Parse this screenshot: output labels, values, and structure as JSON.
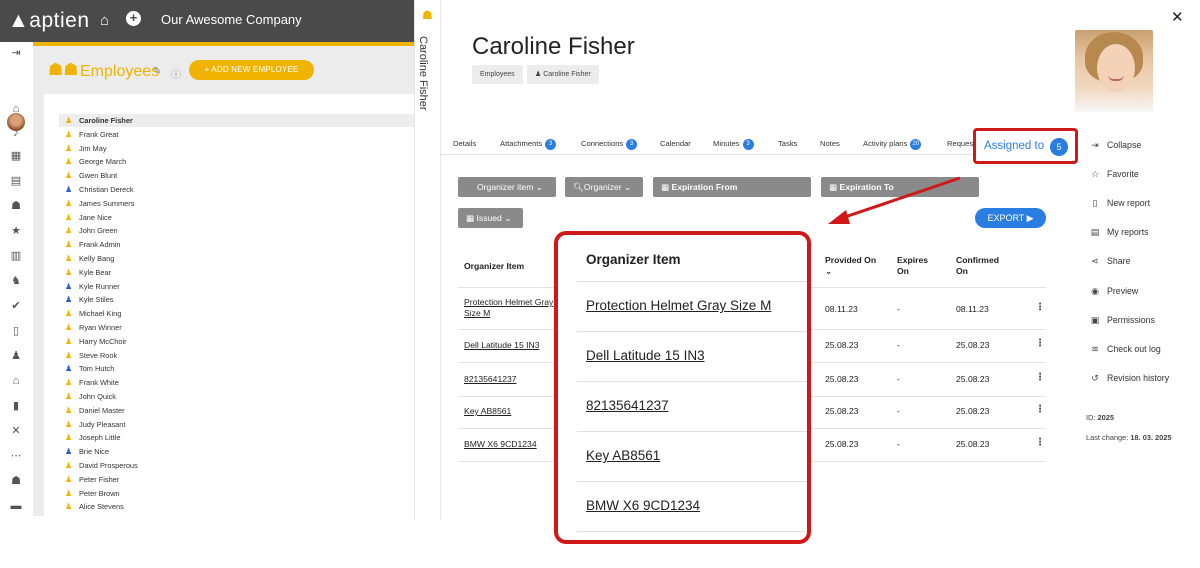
{
  "topbar": {
    "logo_text": "aptien",
    "company": "Our Awesome Company"
  },
  "icons": {
    "home": "home-icon",
    "add": "plus-circle-icon",
    "people": "people-icon",
    "close": "close-icon"
  },
  "employees": {
    "title": "Employees",
    "add_button": "+ ADD NEW EMPLOYEE",
    "list": [
      {
        "name": "Caroline Fisher",
        "selected": true,
        "color": "#f0b400"
      },
      {
        "name": "Frank Great",
        "color": "#f0b400"
      },
      {
        "name": "Jim May",
        "color": "#f0b400"
      },
      {
        "name": "George March",
        "color": "#f0b400"
      },
      {
        "name": "Gwen Blunt",
        "color": "#f0b400"
      },
      {
        "name": "Christian Dereck",
        "color": "#2a5bd7"
      },
      {
        "name": "James Summers",
        "color": "#f0b400"
      },
      {
        "name": "Jane Nice",
        "color": "#f0b400"
      },
      {
        "name": "John Green",
        "color": "#f0b400"
      },
      {
        "name": "Frank Admin",
        "color": "#f0b400"
      },
      {
        "name": "Kelly Bang",
        "color": "#f0b400"
      },
      {
        "name": "Kyle Bear",
        "color": "#f0b400"
      },
      {
        "name": "Kyle Runner",
        "color": "#2a5bd7"
      },
      {
        "name": "Kyle Stiles",
        "color": "#2a5bd7"
      },
      {
        "name": "Michael King",
        "color": "#f0b400"
      },
      {
        "name": "Ryan Winner",
        "color": "#f0b400"
      },
      {
        "name": "Harry McChoir",
        "color": "#f0b400"
      },
      {
        "name": "Steve Rook",
        "color": "#f0b400"
      },
      {
        "name": "Tom Hutch",
        "color": "#2a5bd7"
      },
      {
        "name": "Frank White",
        "color": "#f0b400"
      },
      {
        "name": "John Quick",
        "color": "#f0b400"
      },
      {
        "name": "Daniel Master",
        "color": "#f0b400"
      },
      {
        "name": "Judy Pleasant",
        "color": "#f0b400"
      },
      {
        "name": "Joseph Little",
        "color": "#f0b400"
      },
      {
        "name": "Brie Nice",
        "color": "#2a5bd7"
      },
      {
        "name": "David Prosperous",
        "color": "#f0b400"
      },
      {
        "name": "Peter Fisher",
        "color": "#f0b400"
      },
      {
        "name": "Peter Brown",
        "color": "#f0b400"
      },
      {
        "name": "Alice Stevens",
        "color": "#f0b400"
      }
    ]
  },
  "vertical_tab": "Caroline Fisher",
  "detail": {
    "name": "Caroline Fisher",
    "breadcrumbs": [
      "Employees",
      "Caroline Fisher"
    ],
    "tabs": [
      {
        "label": "Details"
      },
      {
        "label": "Attachments",
        "badge": "3"
      },
      {
        "label": "Connections",
        "badge": "3"
      },
      {
        "label": "Calendar"
      },
      {
        "label": "Minutes",
        "badge": "3"
      },
      {
        "label": "Tasks"
      },
      {
        "label": "Notes"
      },
      {
        "label": "Activity plans",
        "badge": "20"
      },
      {
        "label": "Reques"
      }
    ],
    "assigned_tab": {
      "label": "Assigned to",
      "badge": "5"
    },
    "filters": {
      "organizer_item": "Organizer item",
      "organizer": "Organizer",
      "expiration_from": "Expiration From",
      "expiration_to": "Expiration To",
      "issued": "Issued"
    },
    "export_label": "EXPORT",
    "table": {
      "headers": {
        "organizer_item": "Organizer Item",
        "provided_on": "Provided On",
        "expires_on": "Expires On",
        "confirmed_on": "Confirmed On"
      },
      "rows": [
        {
          "item": "Protection Helmet Gray Size M",
          "provided": "08.11.23",
          "expires": "-",
          "confirmed": "08.11.23"
        },
        {
          "item": "Dell Latitude 15 IN3",
          "provided": "25.08.23",
          "expires": "-",
          "confirmed": "25.08.23"
        },
        {
          "item": "82135641237",
          "provided": "25.08.23",
          "expires": "-",
          "confirmed": "25.08.23"
        },
        {
          "item": "Key AB8561",
          "provided": "25.08.23",
          "expires": "-",
          "confirmed": "25.08.23"
        },
        {
          "item": "BMW X6 9CD1234",
          "provided": "25.08.23",
          "expires": "-",
          "confirmed": "25.08.23"
        }
      ]
    }
  },
  "side_menu": [
    {
      "label": "Collapse",
      "icon": "collapse-icon"
    },
    {
      "label": "Favorite",
      "icon": "star-icon"
    },
    {
      "label": "New report",
      "icon": "report-icon"
    },
    {
      "label": "My reports",
      "icon": "reports-icon"
    },
    {
      "label": "Share",
      "icon": "share-icon"
    },
    {
      "label": "Preview",
      "icon": "eye-icon"
    },
    {
      "label": "Permissions",
      "icon": "permissions-icon"
    },
    {
      "label": "Check out log",
      "icon": "log-icon"
    },
    {
      "label": "Revision history",
      "icon": "history-icon"
    }
  ],
  "meta": {
    "id_label": "ID:",
    "id_value": "2025",
    "last_change_label": "Last change:",
    "last_change_value": "18. 03. 2025"
  },
  "zoom": {
    "header": "Organizer Item",
    "items": [
      "Protection Helmet Gray Size M",
      "Dell Latitude 15 IN3",
      "82135641237",
      "Key AB8561",
      "BMW X6 9CD1234"
    ]
  },
  "colors": {
    "accent": "#f0b400",
    "primary": "#2a7de1",
    "highlight": "#d01818"
  }
}
